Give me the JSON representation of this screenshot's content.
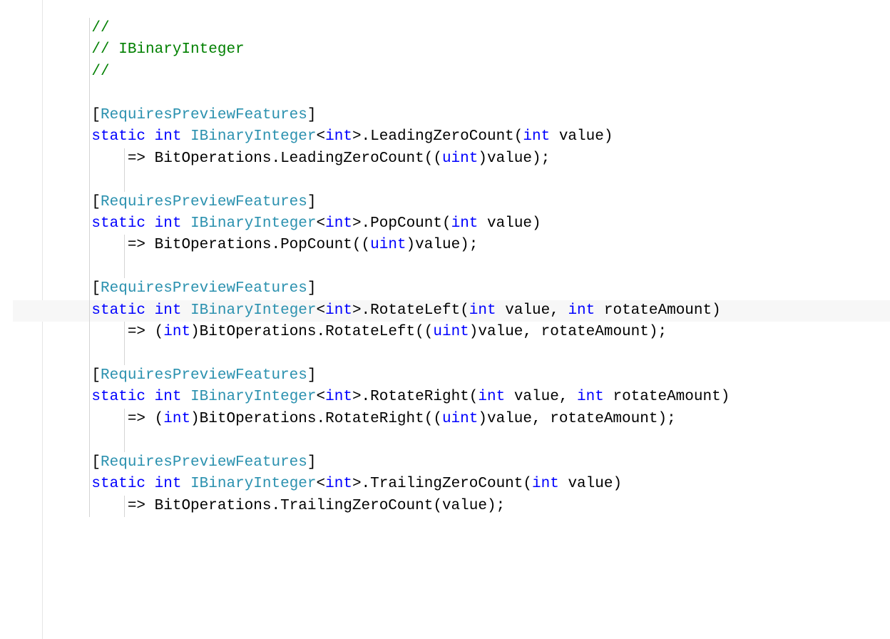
{
  "code": {
    "comment_prefix": "//",
    "comment_section": "// IBinaryInteger",
    "attribute_open": "[",
    "attribute_close": "]",
    "attribute_name": "RequiresPreviewFeatures",
    "kw_static": "static",
    "kw_int": "int",
    "kw_uint": "uint",
    "type_IBinaryInteger": "IBinaryInteger",
    "type_BitOperations": "BitOperations",
    "angle_open": "<",
    "angle_close": ">",
    "dot": ".",
    "paren_open": "(",
    "paren_close": ")",
    "comma_sp": ", ",
    "semicolon": ";",
    "arrow": "=> ",
    "param_value": "value",
    "param_rotateAmount": "rotateAmount",
    "method_LeadingZeroCount": "LeadingZeroCount",
    "method_PopCount": "PopCount",
    "method_RotateLeft": "RotateLeft",
    "method_RotateRight": "RotateRight",
    "method_TrailingZeroCount": "TrailingZeroCount",
    "cast_open": "((",
    "cast_close": ")",
    "sp": " "
  }
}
